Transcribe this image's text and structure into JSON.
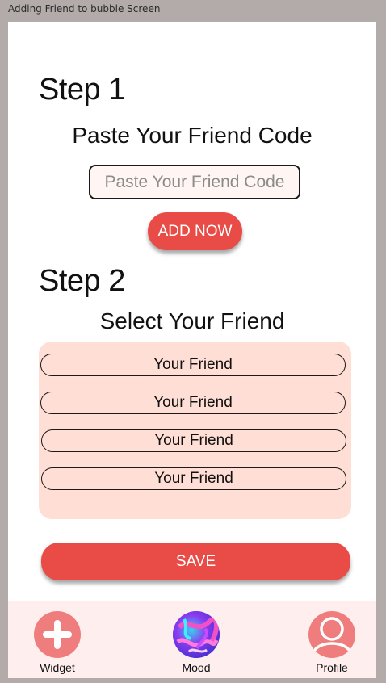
{
  "window": {
    "title": "Adding Friend to bubble Screen"
  },
  "step1": {
    "title": "Step 1",
    "subtitle": "Paste Your Friend Code",
    "input_placeholder": "Paste Your Friend Code",
    "input_value": "",
    "add_button_label": "ADD NOW"
  },
  "step2": {
    "title": "Step 2",
    "subtitle": "Select Your Friend",
    "friends": [
      "Your Friend",
      "Your Friend",
      "Your Friend",
      "Your Friend"
    ]
  },
  "save_button_label": "SAVE",
  "bottom_nav": {
    "items": [
      {
        "label": "Widget",
        "icon": "plus-icon"
      },
      {
        "label": "Mood",
        "icon": "mood-swirl-icon"
      },
      {
        "label": "Profile",
        "icon": "profile-icon"
      }
    ]
  },
  "colors": {
    "accent": "#e94c46",
    "panel": "#ffded5",
    "nav_background": "#ffeeee",
    "icon_circle": "#f07d7d"
  }
}
